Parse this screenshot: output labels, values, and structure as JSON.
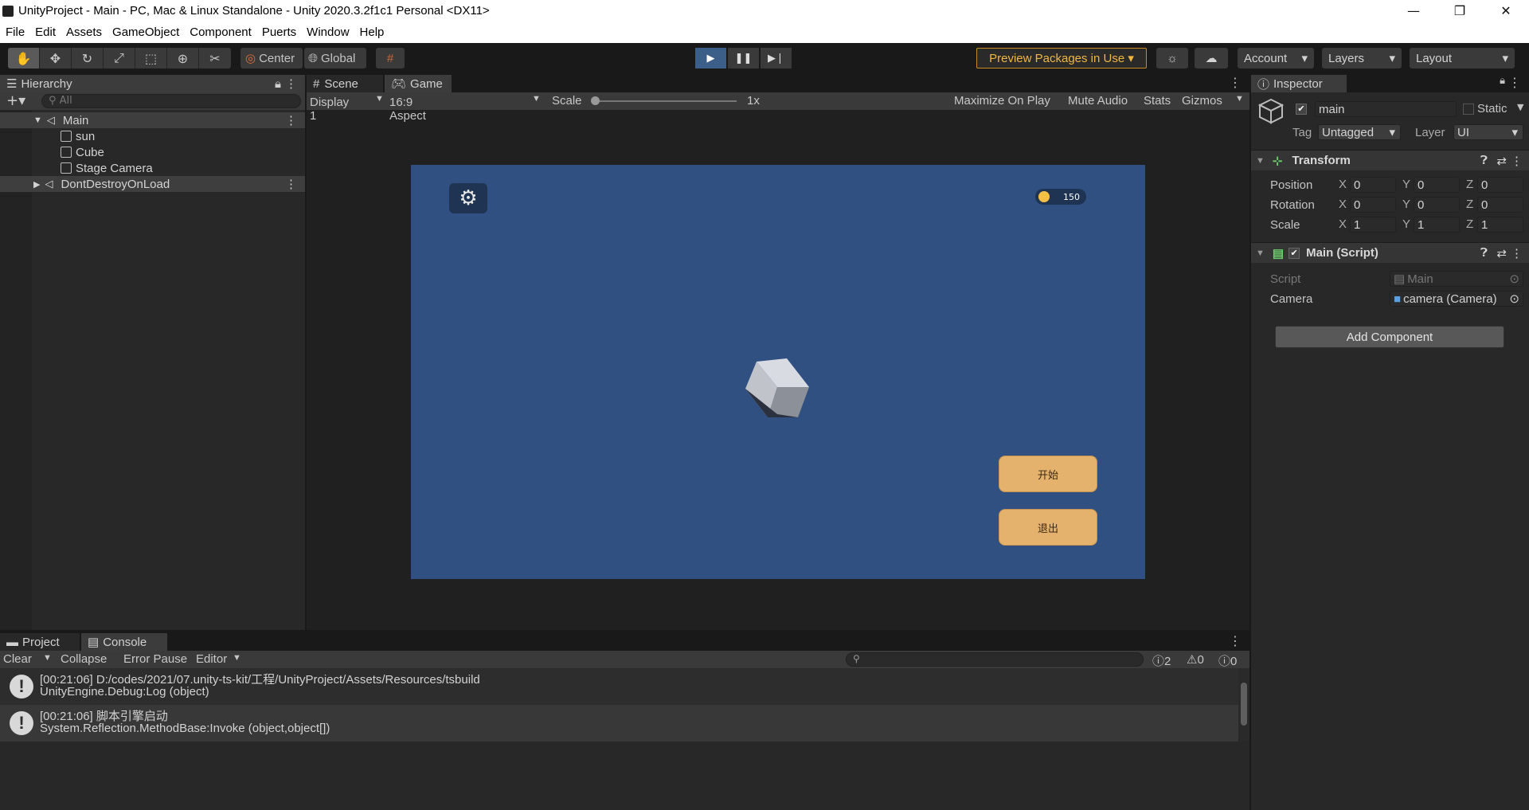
{
  "window": {
    "title": "UnityProject - Main - PC, Mac & Linux Standalone - Unity 2020.3.2f1c1 Personal <DX11>",
    "minimize": "—",
    "restore": "❐",
    "close": "✕"
  },
  "menu": [
    "File",
    "Edit",
    "Assets",
    "GameObject",
    "Component",
    "Puerts",
    "Window",
    "Help"
  ],
  "toolbar": {
    "pivot": "Center",
    "space": "Global",
    "preview_packages": "Preview Packages in Use ▾",
    "account": "Account",
    "layers": "Layers",
    "layout": "Layout"
  },
  "hierarchy": {
    "tab": "Hierarchy",
    "search_placeholder": "All",
    "items": [
      {
        "label": "Main"
      },
      {
        "label": "sun"
      },
      {
        "label": "Cube"
      },
      {
        "label": "Stage Camera"
      },
      {
        "label": "DontDestroyOnLoad"
      }
    ]
  },
  "scene_tabs": {
    "scene": "Scene",
    "game": "Game"
  },
  "gamebar": {
    "display": "Display 1",
    "aspect": "16:9 Aspect",
    "scale_label": "Scale",
    "scale_value": "1x",
    "maximize": "Maximize On Play",
    "mute": "Mute Audio",
    "stats": "Stats",
    "gizmos": "Gizmos"
  },
  "game": {
    "coins": "150",
    "start_button": "开始",
    "exit_button": "退出"
  },
  "inspector": {
    "tab": "Inspector",
    "object_name": "main",
    "static_label": "Static",
    "tag_label": "Tag",
    "tag_value": "Untagged",
    "layer_label": "Layer",
    "layer_value": "UI",
    "transform": {
      "title": "Transform",
      "position_label": "Position",
      "rotation_label": "Rotation",
      "scale_label": "Scale",
      "position": [
        "0",
        "0",
        "0"
      ],
      "rotation": [
        "0",
        "0",
        "0"
      ],
      "scale": [
        "1",
        "1",
        "1"
      ]
    },
    "script_component": {
      "title": "Main (Script)",
      "script_label": "Script",
      "script_value": "Main",
      "camera_label": "Camera",
      "camera_value": "camera (Camera)"
    },
    "add_component": "Add Component"
  },
  "bottom_tabs": {
    "project": "Project",
    "console": "Console"
  },
  "console": {
    "clear": "Clear",
    "collapse": "Collapse",
    "error_pause": "Error Pause",
    "editor": "Editor",
    "count_log": "2",
    "count_warn": "0",
    "count_error": "0",
    "entries": [
      {
        "line1": "[00:21:06] D:/codes/2021/07.unity-ts-kit/工程/UnityProject/Assets/Resources/tsbuild",
        "line2": "UnityEngine.Debug:Log (object)"
      },
      {
        "line1": "[00:21:06] 脚本引擎启动",
        "line2": "System.Reflection.MethodBase:Invoke (object,object[])"
      }
    ]
  }
}
